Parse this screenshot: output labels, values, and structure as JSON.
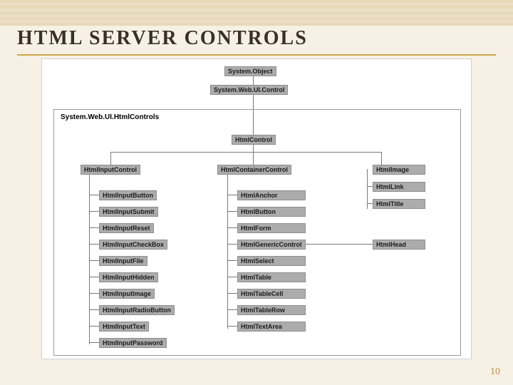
{
  "title": "HTML SERVER CONTROLS",
  "page_number": "10",
  "namespace": "System.Web.UI.HtmlControls",
  "root1": "System.Object",
  "root2": "System.Web.UI.Control",
  "html_control": "HtmlControl",
  "branch_input": "HtmlInputControl",
  "branch_container": "HtmlContainerControl",
  "leaf_image": "HtmlImage",
  "leaf_link": "HtmlLink",
  "leaf_title": "HtmlTitle",
  "leaf_head": "HtmlHead",
  "input_children": [
    "HtmlInputButton",
    "HtmlInputSubmit",
    "HtmlInputReset",
    "HtmlInputCheckBox",
    "HtmlInputFile",
    "HtmlInputHidden",
    "HtmlInputImage",
    "HtmlInputRadioButton",
    "HtmlInputText",
    "HtmlInputPassword"
  ],
  "container_children": [
    "HtmlAnchor",
    "HtmlButton",
    "HtmlForm",
    "HtmlGenericControl",
    "HtmlSelect",
    "HtmlTable",
    "HtmlTableCell",
    "HtmlTableRow",
    "HtmlTextArea"
  ]
}
